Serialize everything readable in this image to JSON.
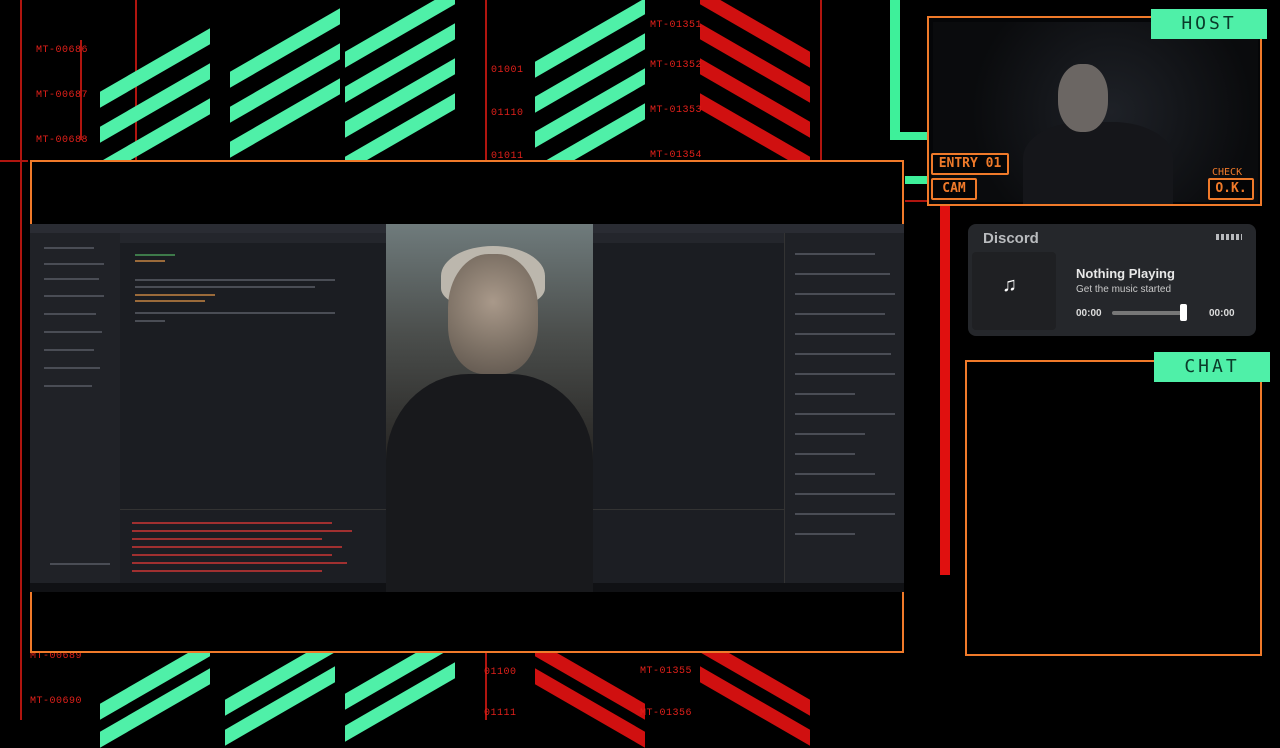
{
  "background": {
    "left_codes": [
      "MT-00686",
      "MT-00687",
      "MT-00688",
      "MT-00689",
      "MT-00690"
    ],
    "center_codes": [
      "MT-01351",
      "MT-01352",
      "MT-01353",
      "MT-01354",
      "MT-01355",
      "MT-01356"
    ],
    "binary": [
      "01001",
      "01110",
      "01011",
      "01100",
      "01111"
    ]
  },
  "host": {
    "tag": "HOST",
    "entry_label": "ENTRY 01",
    "cam_label": "CAM",
    "check_label": "CHECK",
    "ok_label": "O.K."
  },
  "discord": {
    "title": "Discord",
    "track_title": "Nothing Playing",
    "track_subtitle": "Get the music started",
    "time_start": "00:00",
    "time_end": "00:00",
    "music_icon": "music-note-icon",
    "progress": 1.0
  },
  "chat": {
    "tag": "CHAT"
  },
  "colors": {
    "accent_orange": "#f07a2a",
    "accent_green": "#4ff0a8",
    "accent_red": "#d01010",
    "discord_bg": "#25272b"
  }
}
